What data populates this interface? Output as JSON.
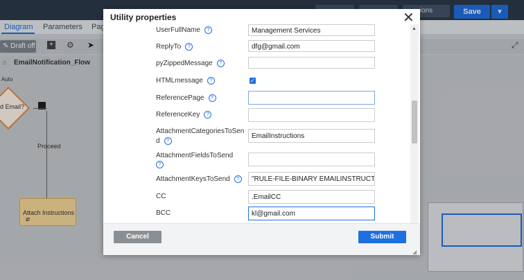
{
  "app": {
    "save_label": "Save",
    "options_label": "ions",
    "tabs": [
      {
        "label": "Diagram"
      },
      {
        "label": "Parameters"
      },
      {
        "label": "Pag"
      }
    ],
    "draft_label": "Draft off",
    "flow_name": "EmailNotification_Flow",
    "auto_label": "Auto",
    "decision_label": "d Email?",
    "proceed_label": "Proceed",
    "attach_label": "Attach Instructions"
  },
  "modal": {
    "title": "Utility properties",
    "fields": [
      {
        "label": "UserFullName",
        "value": "Management Services"
      },
      {
        "label": "ReplyTo",
        "value": "dfg@gmail.com"
      },
      {
        "label": "pyZippedMessage",
        "value": ""
      },
      {
        "label": "HTMLmessage",
        "value": ""
      },
      {
        "label": "ReferencePage",
        "value": ""
      },
      {
        "label": "ReferenceKey",
        "value": ""
      },
      {
        "label_line1": "AttachmentCategoriesToSen",
        "label_line2": "d",
        "value": "EmailInstructions"
      },
      {
        "label": "AttachmentFieldsToSend",
        "value": ""
      },
      {
        "label": "AttachmentKeysToSend",
        "value": "\"RULE-FILE-BINARY EMAILINSTRUCTIONS"
      },
      {
        "label": "CC",
        "value": ".EmailCC"
      },
      {
        "label": "BCC",
        "value": "kl@gmail.com"
      }
    ],
    "cancel_label": "Cancel",
    "submit_label": "Submit"
  }
}
